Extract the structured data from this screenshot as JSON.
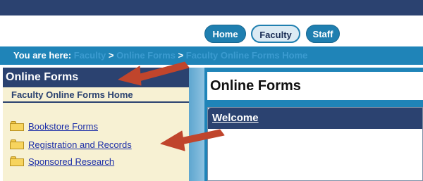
{
  "header": {
    "tabs": [
      {
        "label": "Home"
      },
      {
        "label": "Faculty"
      },
      {
        "label": "Staff"
      }
    ]
  },
  "breadcrumb": {
    "label": "You are here:",
    "items": [
      "Faculty",
      "Online Forms",
      "Faculty Online Forms Home"
    ],
    "separator": ">"
  },
  "sidebar": {
    "title": "Online Forms",
    "subtitle": "Faculty Online Forms Home",
    "items": [
      {
        "label": "Bookstore Forms",
        "icon": "folder-icon"
      },
      {
        "label": "Registration and Records",
        "icon": "folder-icon"
      },
      {
        "label": "Sponsored Research",
        "icon": "folder-icon"
      }
    ]
  },
  "main": {
    "title": "Online Forms",
    "welcome_heading": "Welcome"
  },
  "colors": {
    "navy": "#2b4270",
    "blue": "#1f84b8",
    "sidebar_bg": "#f7f1d3",
    "link": "#1c2ea8",
    "annotation_arrow": "#c0452c"
  }
}
